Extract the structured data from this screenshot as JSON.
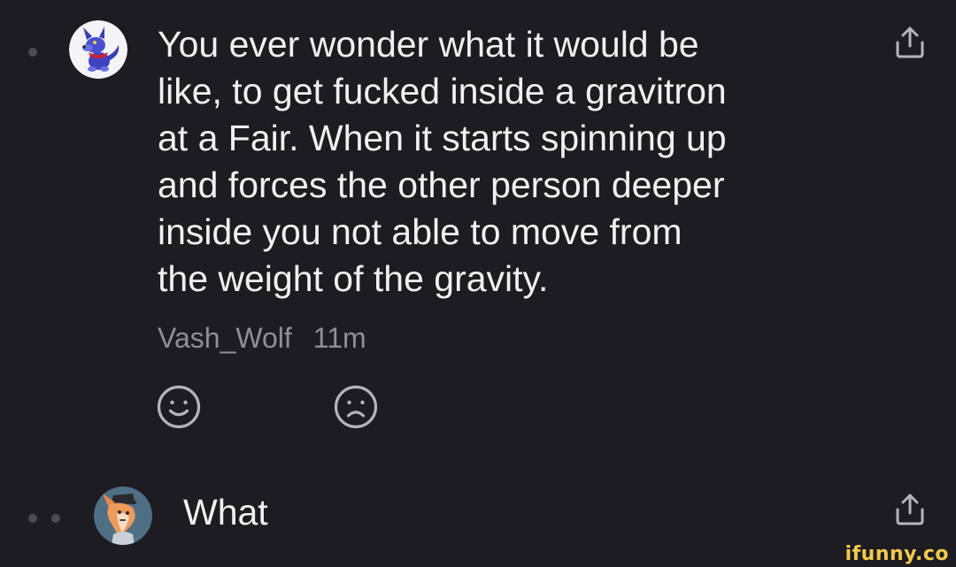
{
  "comment": {
    "text": "You ever wonder what it would be\nlike, to get fucked inside a gravitron\nat a Fair. When it starts spinning up\nand forces the other person deeper\ninside you not able to move from\nthe weight of the gravity.",
    "username": "Vash_Wolf",
    "time": "11m",
    "avatar_icon": "wolf-avatar-icon",
    "share_icon": "share-icon",
    "reactions": [
      {
        "icon": "smile-icon"
      },
      {
        "icon": "frown-icon"
      }
    ]
  },
  "reply": {
    "text": "What",
    "avatar_icon": "fox-avatar-icon",
    "share_icon": "share-icon"
  },
  "watermark": "ifunny.co",
  "colors": {
    "background": "#1d1c21",
    "text": "#f0f0f2",
    "meta": "#8f8f96",
    "icon": "#b4b4bb",
    "watermark": "#f2c94c"
  }
}
